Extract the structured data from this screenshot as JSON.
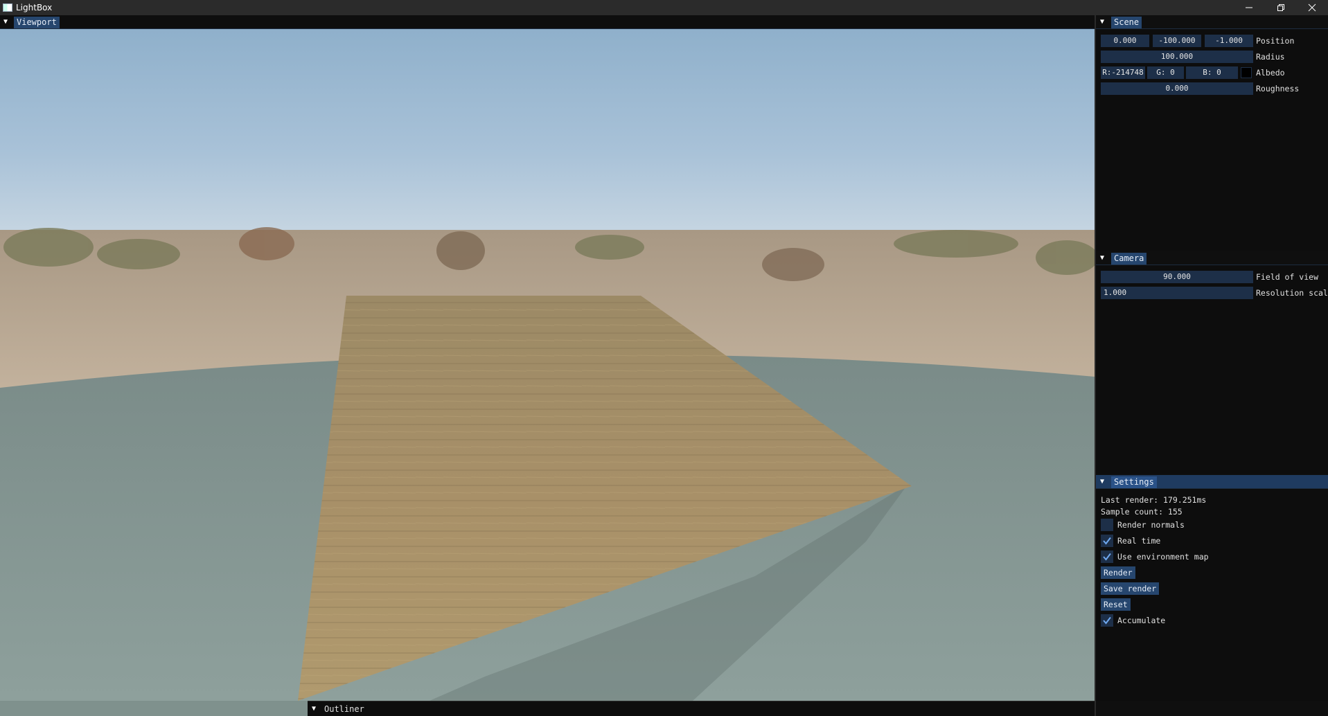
{
  "window": {
    "title": "LightBox"
  },
  "viewport": {
    "tab_label": "Viewport"
  },
  "scene": {
    "tab_label": "Scene",
    "position": {
      "x": "0.000",
      "y": "-100.000",
      "z": "-1.000",
      "label": "Position"
    },
    "radius": {
      "value": "100.000",
      "label": "Radius"
    },
    "albedo": {
      "r": "R:-214748",
      "g": "G:  0",
      "b": "B:  0",
      "label": "Albedo",
      "swatch_color": "#000000"
    },
    "roughness": {
      "value": "0.000",
      "label": "Roughness"
    }
  },
  "camera": {
    "tab_label": "Camera",
    "fov": {
      "value": "90.000",
      "label": "Field of view"
    },
    "resolution": {
      "value": "1.000",
      "label": "Resolution scal"
    }
  },
  "settings": {
    "tab_label": "Settings",
    "last_render": "Last render: 179.251ms",
    "sample_count": "Sample count: 155",
    "render_normals": {
      "label": "Render normals",
      "checked": false
    },
    "real_time": {
      "label": "Real time",
      "checked": true
    },
    "use_env_map": {
      "label": "Use environment map",
      "checked": true
    },
    "render_button": "Render",
    "save_button": "Save render",
    "reset_button": "Reset",
    "accumulate": {
      "label": "Accumulate",
      "checked": true
    }
  },
  "outliner": {
    "label": "Outliner"
  },
  "colors": {
    "accent": "#26466e",
    "field_bg": "#1d2f48",
    "panel_bg": "#0d0d0d"
  }
}
